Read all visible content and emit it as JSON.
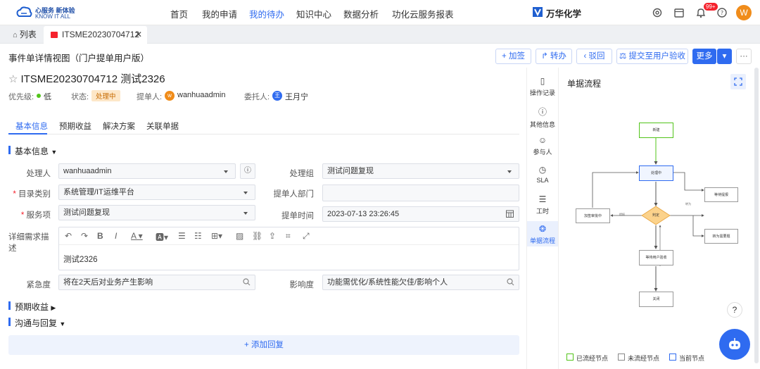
{
  "logo": {
    "line1": "心服务 新体验",
    "line2": "KNOW IT ALL"
  },
  "nav": [
    "首页",
    "我的申请",
    "我的待办",
    "知识中心",
    "数据分析",
    "功化云服务报表"
  ],
  "company": "万华化学",
  "notif_badge": "99+",
  "user_initial": "W",
  "tabs": {
    "list": "列表",
    "ticket": "ITSME20230704712"
  },
  "header": {
    "title": "事件单详情视图（门户提单用户版）",
    "buttons": {
      "add": "+ 加签",
      "transfer": "转办",
      "reject": "驳回",
      "submit": "提交至用户验收",
      "more": "更多"
    }
  },
  "ticket": {
    "title": "ITSME20230704712  测试2326",
    "priority_label": "优先级:",
    "priority": "低",
    "status_label": "状态:",
    "status": "处理中",
    "creator_label": "提单人:",
    "creator": "wanhuaadmin",
    "creator_initial": "w",
    "delegate_label": "委托人:",
    "delegate": "王月宁",
    "delegate_initial": "王"
  },
  "subtabs": [
    "基本信息",
    "预期收益",
    "解决方案",
    "关联单据"
  ],
  "sections": {
    "basic": "基本信息",
    "benefit": "预期收益",
    "comm": "沟通与回复"
  },
  "form": {
    "handler_label": "处理人",
    "handler": "wanhuaadmin",
    "group_label": "处理组",
    "group": "测试问题复现",
    "catalog_label": "目录类别",
    "catalog": "系统管理/IT运维平台",
    "dept_label": "提单人部门",
    "dept": "",
    "service_label": "服务项",
    "service": "测试问题复现",
    "time_label": "提单时间",
    "time": "2023-07-13 23:26:45",
    "desc_label": "详细需求描述",
    "desc": "测试2326",
    "urgency_label": "紧急度",
    "urgency": "将在2天后对业务产生影响",
    "impact_label": "影响度",
    "impact": "功能需优化/系统性能欠佳/影响个人"
  },
  "reply": "+ 添加回复",
  "sidebar": [
    "操作记录",
    "其他信息",
    "参与人",
    "SLA",
    "工时",
    "单据流程"
  ],
  "flow": {
    "title": "单据流程",
    "nodes": {
      "new": "新建",
      "processing": "处理中",
      "wait": "等待提报",
      "judge": "判定",
      "transfer": "转为需要题",
      "check": "加签审批中",
      "accept": "等待用户验收",
      "close": "关闭"
    },
    "edges": {
      "a": "提报",
      "b": "转为"
    }
  },
  "legend": {
    "passed": "已流经节点",
    "unpassed": "未流经节点",
    "current": "当前节点"
  },
  "colors": {
    "accent": "#2f6bf0",
    "passed": "#52c41a",
    "current": "#2f6bf0"
  }
}
